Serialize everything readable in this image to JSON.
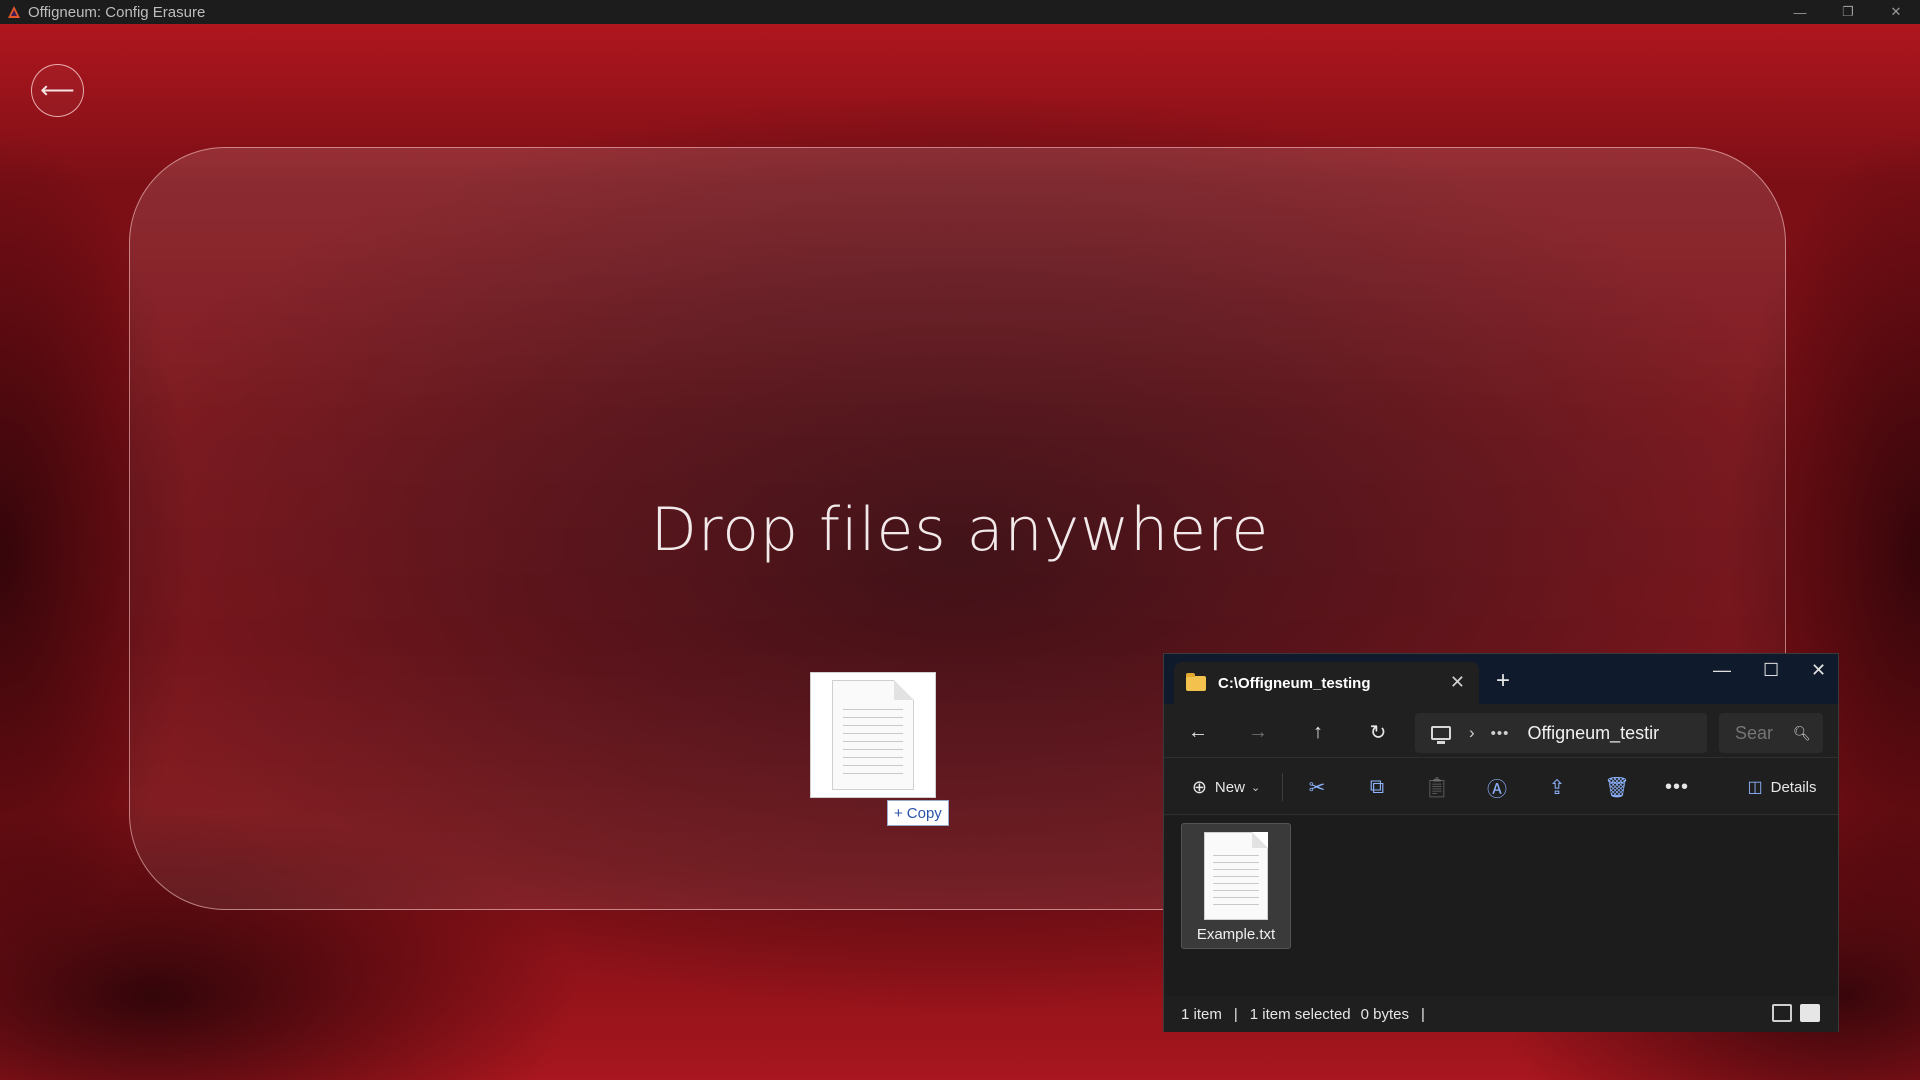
{
  "app": {
    "title": "Offigneum: Config Erasure",
    "back_glyph": "⟵",
    "drop_prompt": "Drop files anywhere"
  },
  "drag": {
    "badge_text": "Copy",
    "badge_prefix": "+"
  },
  "explorer": {
    "tab_title": "C:\\Offigneum_testing",
    "address_crumb": "Offigneum_testir",
    "search_placeholder": "Sear",
    "command_bar": {
      "new_label": "New",
      "details_label": "Details"
    },
    "files": [
      {
        "name": "Example.txt",
        "icon": "text-document-icon",
        "selected": true
      }
    ],
    "status": {
      "item_count": "1 item",
      "selection": "1 item selected",
      "size": "0 bytes"
    }
  },
  "colors": {
    "background_accent": "#8a1018",
    "explorer_tab_bar": "#0f1a2d",
    "command_icon_blue": "#8fb4ff"
  }
}
